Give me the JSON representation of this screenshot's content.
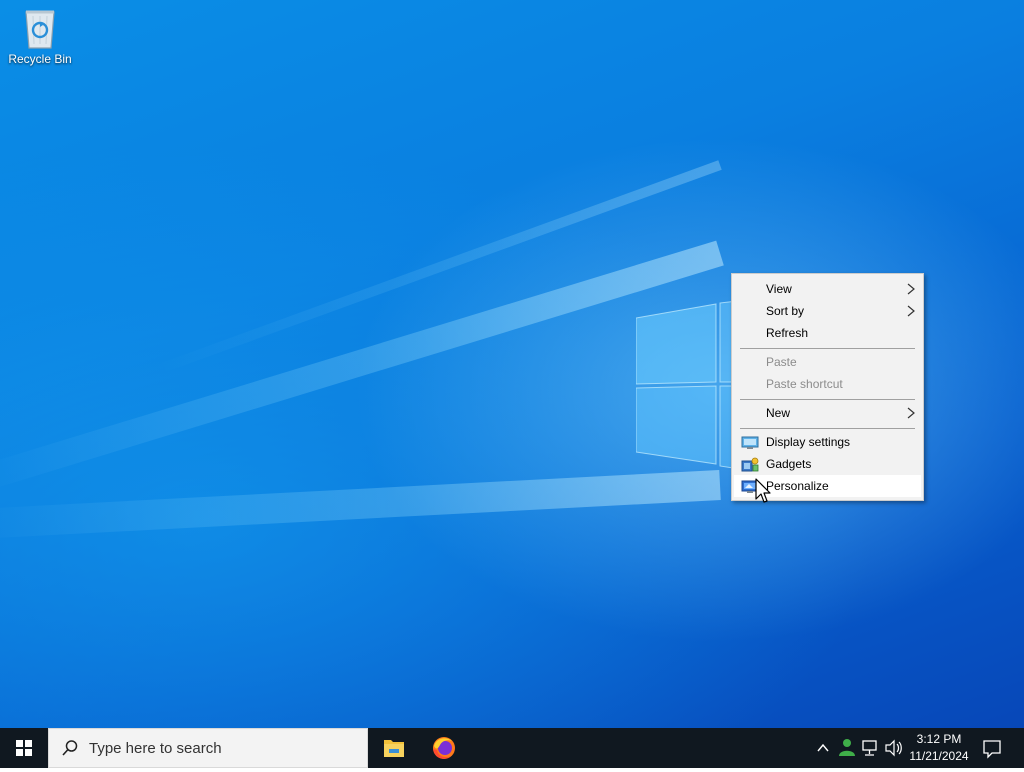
{
  "desktop": {
    "icons": [
      {
        "label": "Recycle Bin",
        "icon": "recycle-bin-icon"
      }
    ]
  },
  "context_menu": {
    "items": [
      {
        "label": "View",
        "submenu": true,
        "enabled": true
      },
      {
        "label": "Sort by",
        "submenu": true,
        "enabled": true
      },
      {
        "label": "Refresh",
        "submenu": false,
        "enabled": true
      },
      {
        "label": "Paste",
        "submenu": false,
        "enabled": false
      },
      {
        "label": "Paste shortcut",
        "submenu": false,
        "enabled": false
      },
      {
        "label": "New",
        "submenu": true,
        "enabled": true
      },
      {
        "label": "Display settings",
        "submenu": false,
        "enabled": true,
        "icon": "display-icon"
      },
      {
        "label": "Gadgets",
        "submenu": false,
        "enabled": true,
        "icon": "gadgets-icon"
      },
      {
        "label": "Personalize",
        "submenu": false,
        "enabled": true,
        "icon": "personalize-icon",
        "highlighted": true
      }
    ]
  },
  "taskbar": {
    "search_placeholder": "Type here to search",
    "pinned_apps": [
      {
        "name": "File Explorer",
        "icon": "folder-icon"
      },
      {
        "name": "Firefox",
        "icon": "firefox-icon"
      }
    ],
    "tray": {
      "time": "3:12 PM",
      "date": "11/21/2024"
    }
  },
  "colors": {
    "taskbar": "#101820",
    "menu_bg": "#f2f2f2",
    "menu_hover": "#ffffff",
    "desktop_accent": "#0a7fe0"
  }
}
